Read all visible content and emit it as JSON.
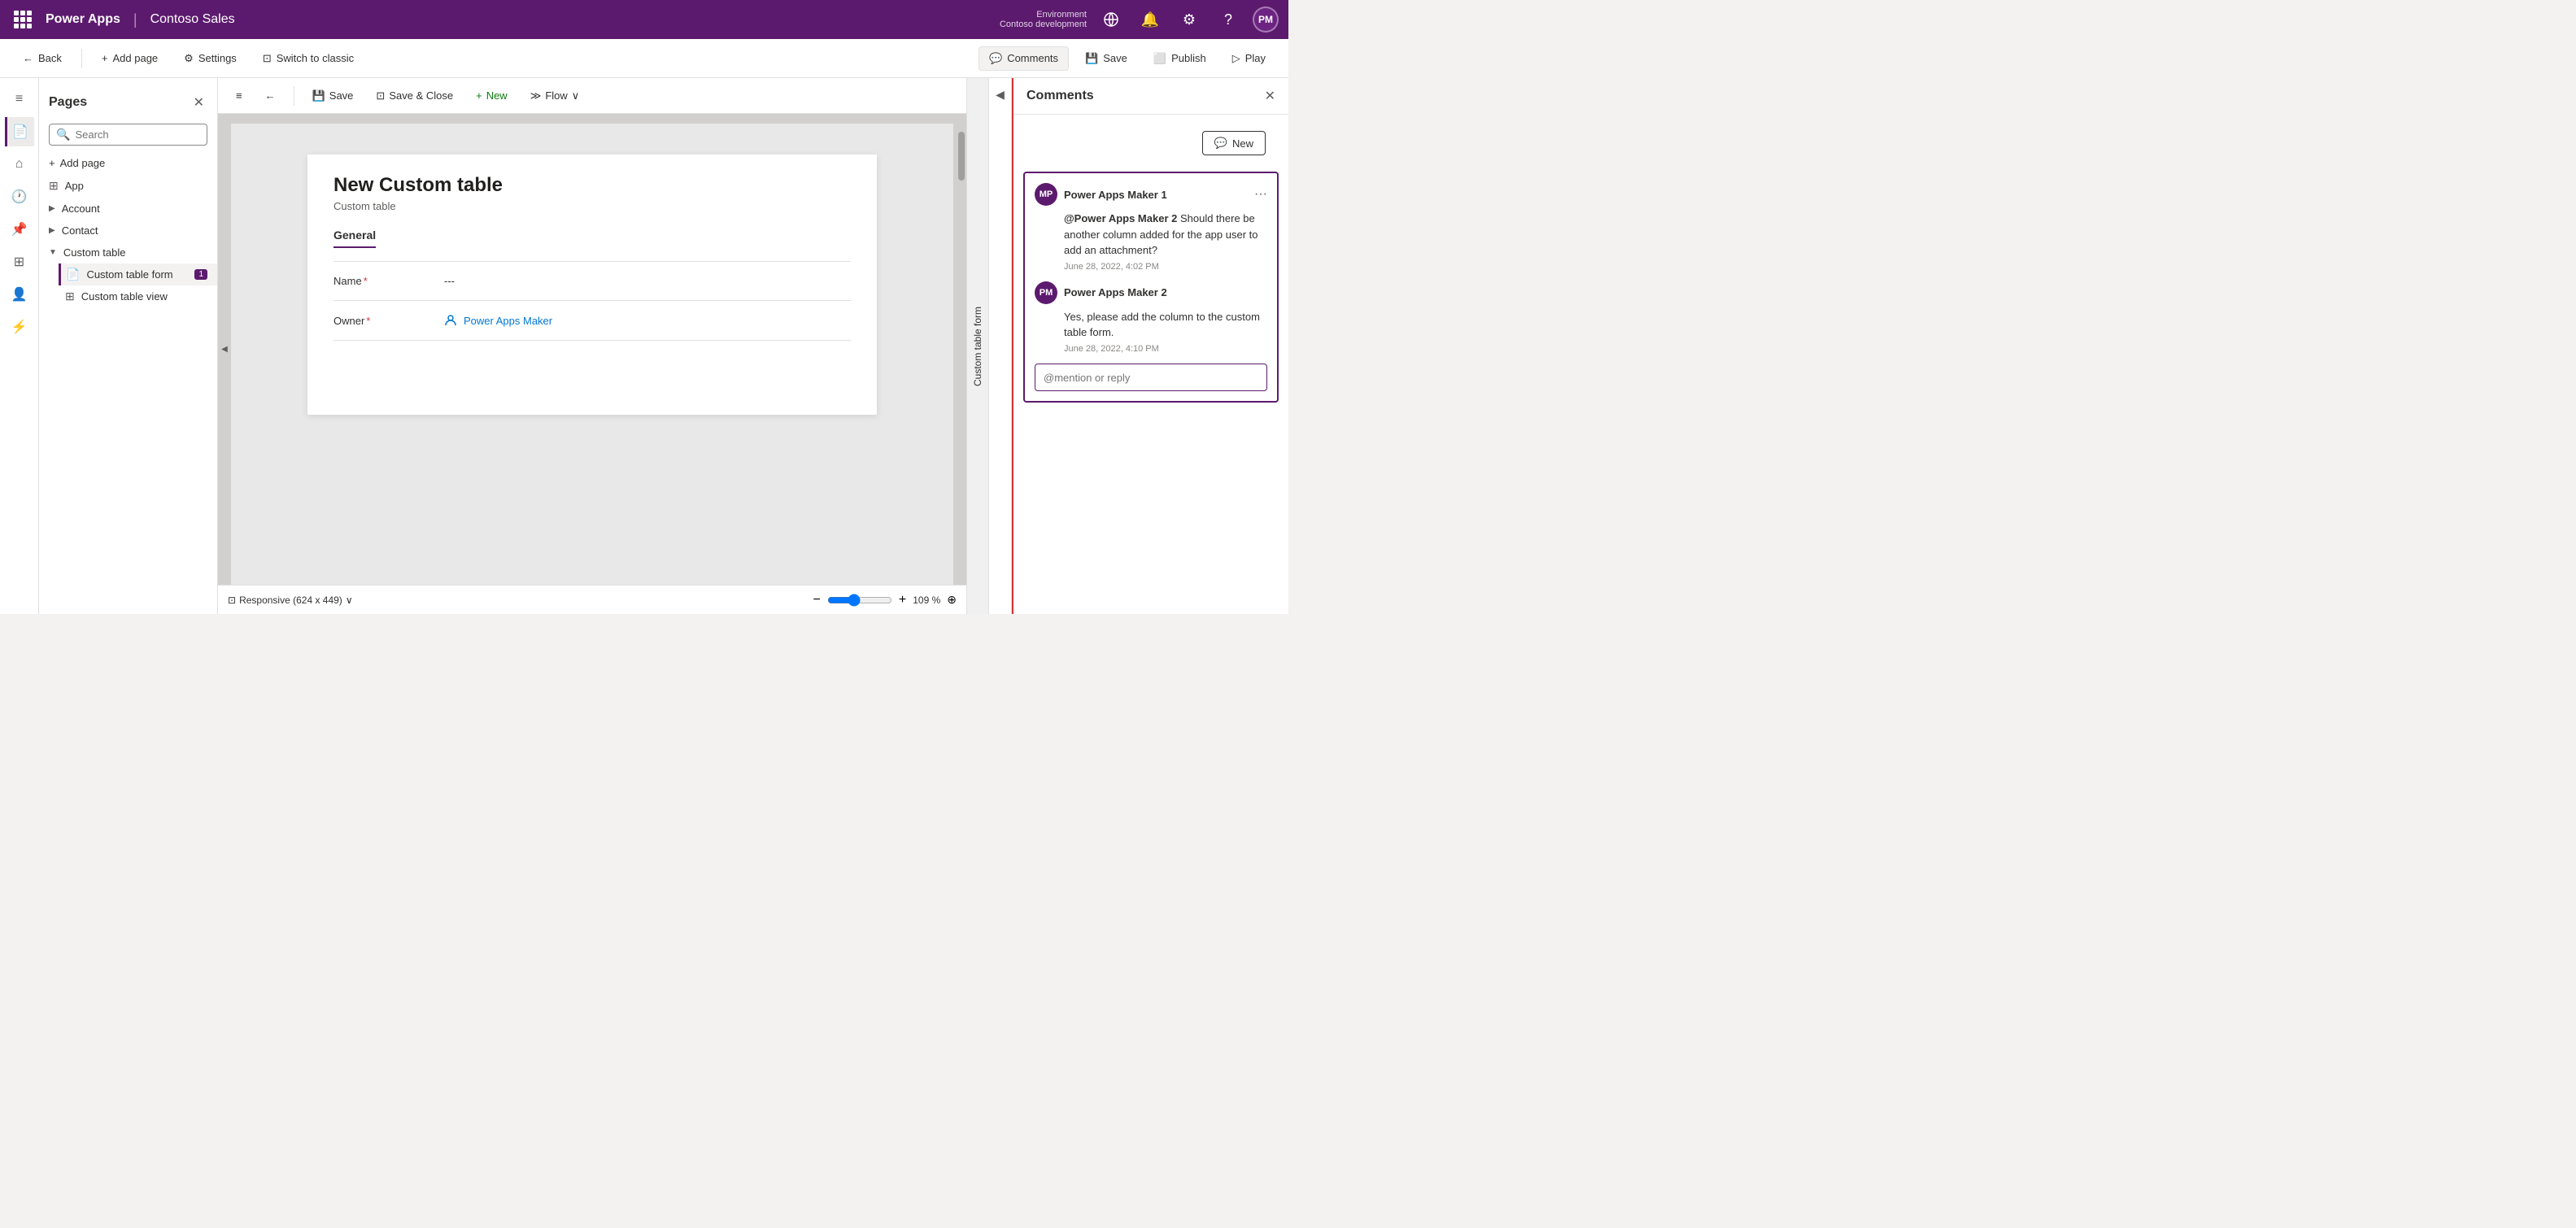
{
  "topnav": {
    "title": "Power Apps",
    "separator": "|",
    "app_name": "Contoso Sales",
    "env_label": "Environment",
    "env_name": "Contoso development",
    "avatar_initials": "PM"
  },
  "secondary_toolbar": {
    "back_label": "Back",
    "add_page_label": "Add page",
    "settings_label": "Settings",
    "switch_label": "Switch to classic",
    "comments_label": "Comments",
    "save_label": "Save",
    "publish_label": "Publish",
    "play_label": "Play"
  },
  "pages_panel": {
    "title": "Pages",
    "search_placeholder": "Search",
    "add_page_label": "Add page",
    "items": [
      {
        "id": "app",
        "label": "App",
        "icon": "⊞",
        "level": 0,
        "expandable": false
      },
      {
        "id": "account",
        "label": "Account",
        "icon": "",
        "level": 0,
        "expandable": true,
        "collapsed": true
      },
      {
        "id": "contact",
        "label": "Contact",
        "icon": "",
        "level": 0,
        "expandable": true,
        "collapsed": true
      },
      {
        "id": "custom-table",
        "label": "Custom table",
        "icon": "",
        "level": 0,
        "expandable": true,
        "collapsed": false
      },
      {
        "id": "custom-table-form",
        "label": "Custom table form",
        "icon": "📄",
        "level": 1,
        "selected": true,
        "badge": "1"
      },
      {
        "id": "custom-table-view",
        "label": "Custom table view",
        "icon": "⊞",
        "level": 1,
        "selected": false
      }
    ]
  },
  "canvas_toolbar": {
    "menu_icon": "≡",
    "back_icon": "←",
    "save_label": "Save",
    "save_close_label": "Save & Close",
    "new_label": "New",
    "flow_label": "Flow",
    "chevron": "∨"
  },
  "form": {
    "title": "New Custom table",
    "subtitle": "Custom table",
    "tab_label": "General",
    "fields": [
      {
        "label": "Name",
        "required": true,
        "value": "---",
        "type": "text"
      },
      {
        "label": "Owner",
        "required": true,
        "value": "Power Apps Maker",
        "type": "owner"
      }
    ]
  },
  "canvas_bottom": {
    "responsive_label": "Responsive (624 x 449)",
    "zoom_minus": "−",
    "zoom_plus": "+",
    "zoom_value": "109 %"
  },
  "vertical_label": "Custom table form",
  "comments_panel": {
    "title": "Comments",
    "close_icon": "✕",
    "new_button_label": "New",
    "thread": {
      "comments": [
        {
          "id": 1,
          "avatar_initials": "MP",
          "username": "Power Apps Maker 1",
          "mention": "@Power Apps Maker 2",
          "text": " Should there be another column added for the app user to add an attachment?",
          "date": "June 28, 2022, 4:02 PM",
          "has_more": true
        },
        {
          "id": 2,
          "avatar_initials": "PM",
          "username": "Power Apps Maker 2",
          "text": "Yes, please add the column to the custom table form.",
          "date": "June 28, 2022, 4:10 PM",
          "has_more": false
        }
      ],
      "reply_placeholder": "@mention or reply"
    }
  }
}
